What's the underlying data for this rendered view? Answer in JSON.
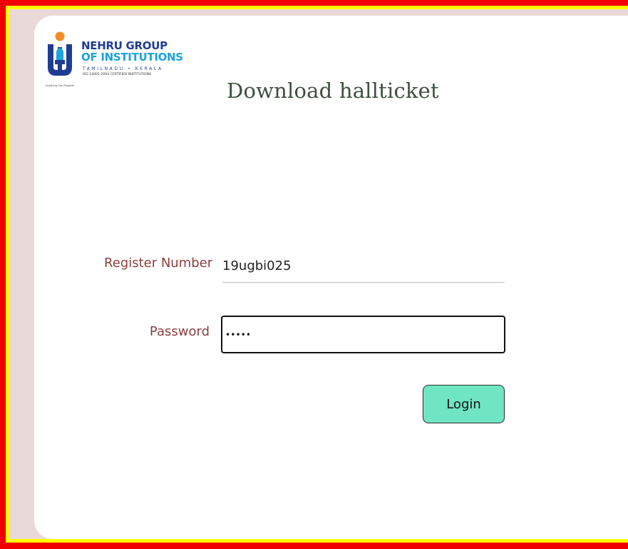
{
  "brand": {
    "name_line1": "NEHRU GROUP",
    "name_line2": "OF INSTITUTIONS",
    "states": "TAMILNADU • KERALA",
    "certification": "ISO 14001-2004 CERTIFIED INSTITUTIONS",
    "tagline": "Anything Can Possible"
  },
  "page": {
    "title": "Download hallticket"
  },
  "form": {
    "register_label": "Register Number",
    "register_value": "19ugbi025",
    "password_label": "Password",
    "password_value": "•••••",
    "login_label": "Login"
  },
  "colors": {
    "outer_border": "#f00000",
    "inner_border": "#ffff00",
    "page_background": "#ead9d9",
    "label_color": "#8a3f3f",
    "button_background": "#6fe5c3",
    "logo_primary": "#1f3c94",
    "logo_accent": "#1aa3dc",
    "logo_flame": "#f28c28"
  }
}
